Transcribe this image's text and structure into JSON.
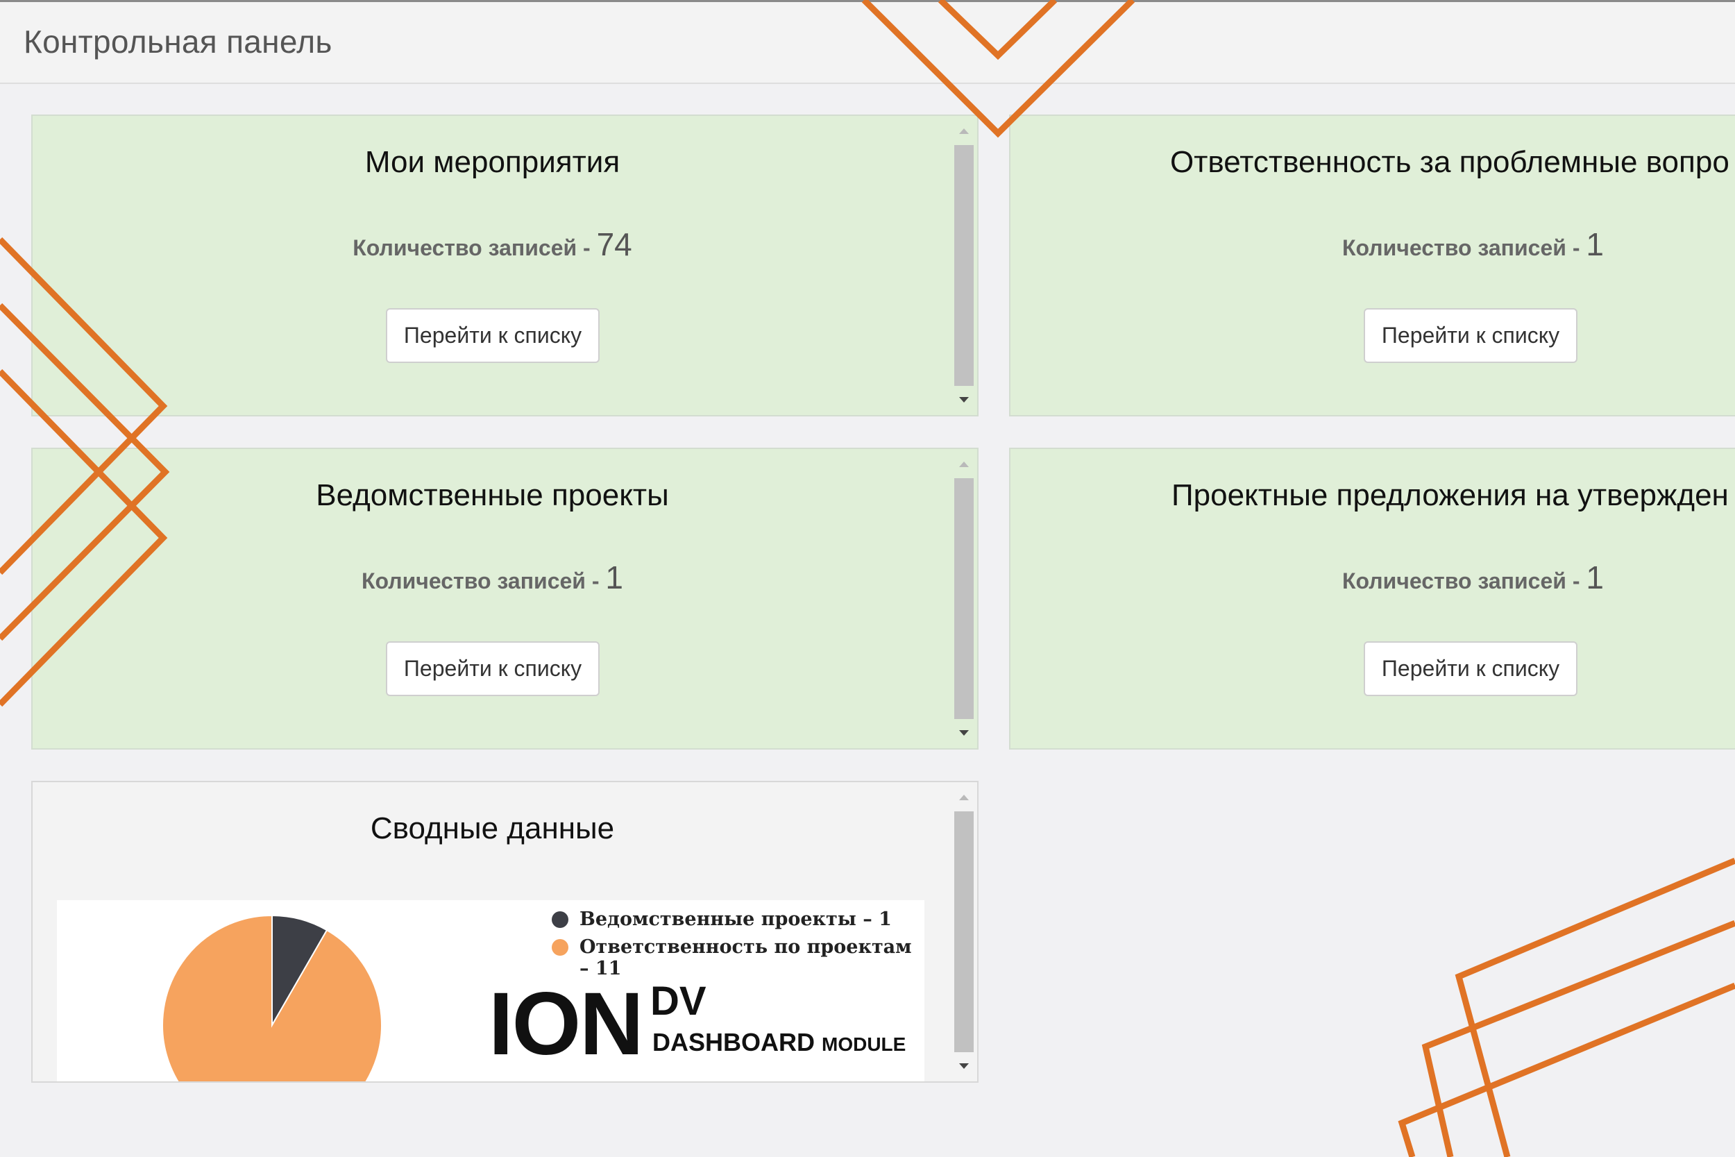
{
  "page": {
    "title": "Контрольная панель"
  },
  "colors": {
    "accent": "#e07325",
    "card_bg": "#e0efd8",
    "pie_main": "#f6a35e",
    "pie_small": "#3d3f46"
  },
  "cards": [
    {
      "title": "Мои мероприятия",
      "count_label": "Количество записей - ",
      "count": "74",
      "button": "Перейти к списку"
    },
    {
      "title": "Ответственность за проблемные вопро",
      "count_label": "Количество записей - ",
      "count": "1",
      "button": "Перейти к списку"
    },
    {
      "title": "Ведомственные проекты",
      "count_label": "Количество записей - ",
      "count": "1",
      "button": "Перейти к списку"
    },
    {
      "title": "Проектные предложения на утвержден",
      "count_label": "Количество записей - ",
      "count": "1",
      "button": "Перейти к списку"
    }
  ],
  "summary": {
    "title": "Сводные данные",
    "legend": [
      {
        "label": "Ведомственные проекты – 1"
      },
      {
        "label": "Ответственность по проектам – 11"
      }
    ],
    "logo": {
      "ion": "ION",
      "dv": "DV",
      "dashboard": "DASHBOARD",
      "module": "MODULE"
    }
  },
  "chart_data": {
    "type": "pie",
    "categories": [
      "Ведомственные проекты",
      "Ответственность по проектам"
    ],
    "values": [
      1,
      11
    ]
  },
  "icons": {
    "scroll_up": "scroll-up-icon",
    "scroll_down": "scroll-down-icon"
  }
}
